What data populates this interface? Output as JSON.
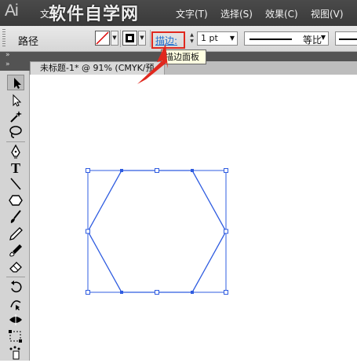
{
  "app": {
    "logo_text": "Ai",
    "watermark": "软件自学网",
    "menus": [
      {
        "label": "文件"
      },
      {
        "label": "文字(T)"
      },
      {
        "label": "选择(S)"
      },
      {
        "label": "效果(C)"
      },
      {
        "label": "视图(V)"
      }
    ]
  },
  "control_bar": {
    "selection_label": "路径",
    "fill_color": "#ffffff",
    "stroke_color": "#000000",
    "stroke_link": "描边:",
    "stroke_weight": "1 pt",
    "profile_label": "等比"
  },
  "tooltip": {
    "text": "描边面板"
  },
  "document": {
    "tab_title": "未标题-1* @ 91% (CMYK/预"
  },
  "tools": [
    {
      "name": "selection-tool-icon"
    },
    {
      "name": "direct-selection-tool-icon"
    },
    {
      "name": "magic-wand-tool-icon"
    },
    {
      "name": "lasso-tool-icon"
    },
    {
      "name": "pen-tool-icon"
    },
    {
      "name": "type-tool-icon"
    },
    {
      "name": "line-segment-tool-icon"
    },
    {
      "name": "polygon-tool-icon"
    },
    {
      "name": "paintbrush-tool-icon"
    },
    {
      "name": "pencil-tool-icon"
    },
    {
      "name": "blob-brush-tool-icon"
    },
    {
      "name": "eraser-tool-icon"
    },
    {
      "name": "rotate-tool-icon"
    },
    {
      "name": "reshape-tool-icon"
    },
    {
      "name": "width-tool-icon"
    },
    {
      "name": "free-transform-tool-icon"
    },
    {
      "name": "symbol-sprayer-tool-icon"
    }
  ],
  "colors": {
    "selection_blue": "#2f5ce0",
    "annotation_red": "#e0281e",
    "link_blue": "#1f6fd0"
  }
}
